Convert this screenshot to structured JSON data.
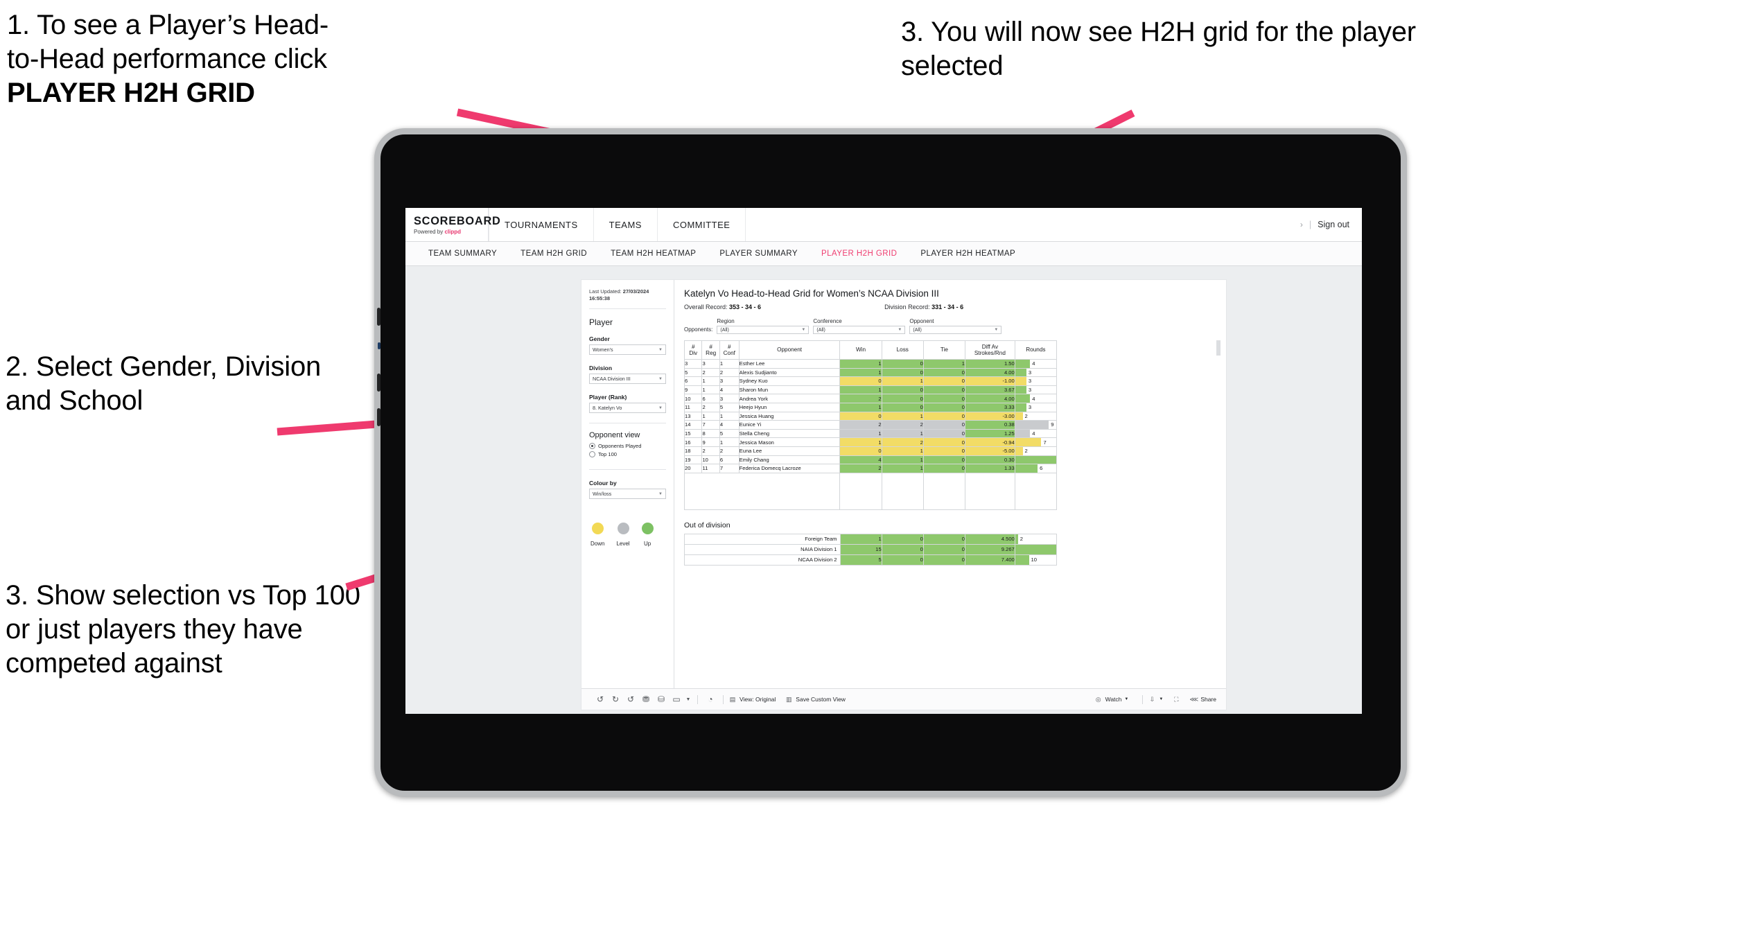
{
  "annotations": {
    "note1_line1": "1. To see a Player’s Head-",
    "note1_line2": "to-Head performance click",
    "note1_bold": "PLAYER H2H GRID",
    "note2": "3. You will now see H2H grid for the player selected",
    "note3": "2. Select Gender, Division and School",
    "note4": "3. Show selection vs Top 100 or just players they have competed against",
    "arrow_color": "#ef3a6e"
  },
  "app": {
    "brand": "SCOREBOARD",
    "brand_sub_prefix": "Powered by ",
    "brand_sub_name": "clippd",
    "top_nav": [
      "TOURNAMENTS",
      "TEAMS",
      "COMMITTEE"
    ],
    "sign_out": "Sign out",
    "sign_out_chevron": "›",
    "sign_out_divider": "|",
    "sub_nav": [
      {
        "label": "TEAM SUMMARY",
        "active": false
      },
      {
        "label": "TEAM H2H GRID",
        "active": false
      },
      {
        "label": "TEAM H2H HEATMAP",
        "active": false
      },
      {
        "label": "PLAYER SUMMARY",
        "active": false
      },
      {
        "label": "PLAYER H2H GRID",
        "active": true
      },
      {
        "label": "PLAYER H2H HEATMAP",
        "active": false
      }
    ],
    "active_tab_color": "#ef3d70"
  },
  "filters": {
    "last_updated_label": "Last Updated: ",
    "last_updated_date": "27/03/2024",
    "last_updated_time": "16:55:38",
    "section_player": "Player",
    "gender_label": "Gender",
    "gender_value": "Women's",
    "division_label": "Division",
    "division_value": "NCAA Division III",
    "player_label": "Player (Rank)",
    "player_value": "8. Katelyn Vo",
    "opponent_view_label": "Opponent view",
    "opponent_view_options": [
      {
        "label": "Opponents Played",
        "selected": true
      },
      {
        "label": "Top 100",
        "selected": false
      }
    ],
    "colour_by_label": "Colour by",
    "colour_by_value": "Win/loss",
    "legend": [
      {
        "label": "Down",
        "color": "#f2d955"
      },
      {
        "label": "Level",
        "color": "#b9bcc0"
      },
      {
        "label": "Up",
        "color": "#7dc163"
      }
    ]
  },
  "view": {
    "title": "Katelyn Vo Head-to-Head Grid for Women’s NCAA Division III",
    "overall_record_label": "Overall Record: ",
    "overall_record_value": "353 -  34 - 6",
    "division_record_label": "Division Record: ",
    "division_record_value": "331 -  34 - 6",
    "opponents_label": "Opponents:",
    "opponent_filters": [
      {
        "caption": "Region",
        "value": "(All)"
      },
      {
        "caption": "Conference",
        "value": "(All)"
      },
      {
        "caption": "Opponent",
        "value": "(All)"
      }
    ]
  },
  "chart_data": {
    "type": "table",
    "title": "Katelyn Vo Head-to-Head Grid for Women’s NCAA Division III",
    "columns": [
      "# Div",
      "# Reg",
      "# Conf",
      "Opponent",
      "Win",
      "Loss",
      "Tie",
      "Diff Av Strokes/Rnd",
      "Rounds"
    ],
    "column_headers_multiline": [
      [
        "#",
        "Div"
      ],
      [
        "#",
        "Reg"
      ],
      [
        "#",
        "Conf"
      ],
      [
        "Opponent"
      ],
      [
        "Win"
      ],
      [
        "Loss"
      ],
      [
        "Tie"
      ],
      [
        "Diff Av",
        "Strokes/Rnd"
      ],
      [
        "Rounds"
      ]
    ],
    "rows": [
      {
        "div": "3",
        "reg": "3",
        "conf": "1",
        "opponent": "Esther Lee",
        "win": "1",
        "loss": "0",
        "tie": "1",
        "diff": "1.50",
        "rounds": "4",
        "status": "up"
      },
      {
        "div": "5",
        "reg": "2",
        "conf": "2",
        "opponent": "Alexis Sudjianto",
        "win": "1",
        "loss": "0",
        "tie": "0",
        "diff": "4.00",
        "rounds": "3",
        "status": "up"
      },
      {
        "div": "6",
        "reg": "1",
        "conf": "3",
        "opponent": "Sydney Kuo",
        "win": "0",
        "loss": "1",
        "tie": "0",
        "diff": "-1.00",
        "rounds": "3",
        "status": "down"
      },
      {
        "div": "9",
        "reg": "1",
        "conf": "4",
        "opponent": "Sharon Mun",
        "win": "1",
        "loss": "0",
        "tie": "0",
        "diff": "3.67",
        "rounds": "3",
        "status": "up"
      },
      {
        "div": "10",
        "reg": "6",
        "conf": "3",
        "opponent": "Andrea York",
        "win": "2",
        "loss": "0",
        "tie": "0",
        "diff": "4.00",
        "rounds": "4",
        "status": "up"
      },
      {
        "div": "11",
        "reg": "2",
        "conf": "5",
        "opponent": "Heejo Hyun",
        "win": "1",
        "loss": "0",
        "tie": "0",
        "diff": "3.33",
        "rounds": "3",
        "status": "up"
      },
      {
        "div": "13",
        "reg": "1",
        "conf": "1",
        "opponent": "Jessica Huang",
        "win": "0",
        "loss": "1",
        "tie": "0",
        "diff": "-3.00",
        "rounds": "2",
        "status": "down"
      },
      {
        "div": "14",
        "reg": "7",
        "conf": "4",
        "opponent": "Eunice Yi",
        "win": "2",
        "loss": "2",
        "tie": "0",
        "diff": "0.38",
        "rounds": "9",
        "status": "level",
        "diff_status": "up"
      },
      {
        "div": "15",
        "reg": "8",
        "conf": "5",
        "opponent": "Stella Cheng",
        "win": "1",
        "loss": "1",
        "tie": "0",
        "diff": "1.25",
        "rounds": "4",
        "status": "level",
        "diff_status": "up"
      },
      {
        "div": "16",
        "reg": "9",
        "conf": "1",
        "opponent": "Jessica Mason",
        "win": "1",
        "loss": "2",
        "tie": "0",
        "diff": "-0.94",
        "rounds": "7",
        "status": "down"
      },
      {
        "div": "18",
        "reg": "2",
        "conf": "2",
        "opponent": "Euna Lee",
        "win": "0",
        "loss": "1",
        "tie": "0",
        "diff": "-5.00",
        "rounds": "2",
        "status": "down"
      },
      {
        "div": "19",
        "reg": "10",
        "conf": "6",
        "opponent": "Emily Chang",
        "win": "4",
        "loss": "1",
        "tie": "0",
        "diff": "0.30",
        "rounds": "11",
        "status": "up"
      },
      {
        "div": "20",
        "reg": "11",
        "conf": "7",
        "opponent": "Federica Domecq Lacroze",
        "win": "2",
        "loss": "1",
        "tie": "0",
        "diff": "1.33",
        "rounds": "6",
        "status": "up"
      }
    ],
    "rounds_max": 11,
    "out_of_division_title": "Out of division",
    "out_of_division": [
      {
        "label": "Foreign Team",
        "win": "1",
        "loss": "0",
        "tie": "0",
        "diff": "4.500",
        "rounds": "2",
        "status": "up"
      },
      {
        "label": "NAIA Division 1",
        "win": "15",
        "loss": "0",
        "tie": "0",
        "diff": "9.267",
        "rounds": "30",
        "status": "up"
      },
      {
        "label": "NCAA Division 2",
        "win": "5",
        "loss": "0",
        "tie": "0",
        "diff": "7.400",
        "rounds": "10",
        "status": "up"
      }
    ],
    "ood_rounds_max": 30,
    "colors": {
      "up": "#8ec86c",
      "down": "#f2dc66",
      "level": "#c9cbce",
      "neutral": "#ffffff"
    }
  },
  "toolbar": {
    "icons": [
      "undo-icon",
      "redo-icon",
      "revert-icon",
      "pause-icon",
      "refresh-icon",
      "layout-icon"
    ],
    "view_label": "View: Original",
    "save_label": "Save Custom View",
    "watch_label": "Watch",
    "share_label": "Share"
  }
}
